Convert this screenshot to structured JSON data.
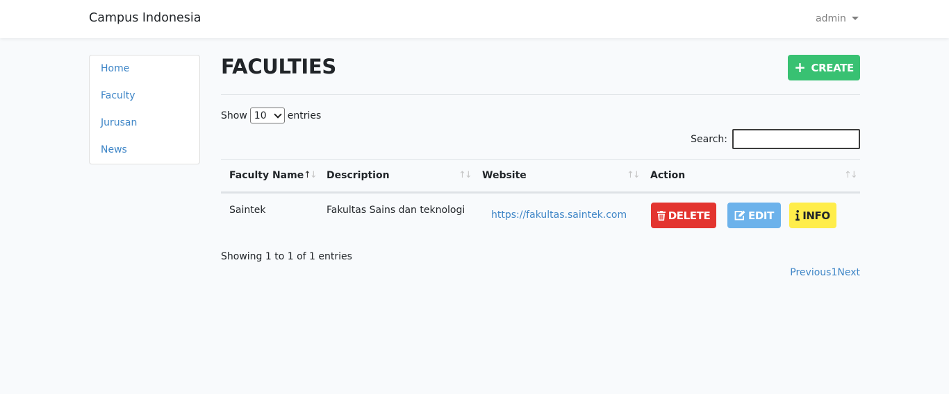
{
  "navbar": {
    "brand": "Campus Indonesia",
    "user": "admin"
  },
  "sidebar": {
    "items": [
      {
        "label": "Home"
      },
      {
        "label": "Faculty"
      },
      {
        "label": "Jurusan"
      },
      {
        "label": "News"
      }
    ]
  },
  "page": {
    "title": "FACULTIES",
    "create_label": "CREATE"
  },
  "datatable": {
    "show_label": "Show",
    "entries_label": "entries",
    "page_length": "10",
    "search_label": "Search:",
    "search_value": "",
    "columns": [
      "Faculty Name",
      "Description",
      "Website",
      "Action"
    ],
    "rows": [
      {
        "name": "Saintek",
        "description": "Fakultas Sains dan teknologi",
        "website": "https://fakultas.saintek.com",
        "actions": {
          "delete": "DELETE",
          "edit": "EDIT",
          "info": "INFO"
        }
      }
    ],
    "info": "Showing 1 to 1 of 1 entries",
    "pagination": {
      "previous": "Previous",
      "current": "1",
      "next": "Next"
    }
  },
  "colors": {
    "primary_link": "#3f86c7",
    "create": "#38c172",
    "delete": "#e3342f",
    "edit": "#6cb2eb",
    "info": "#ffed4a"
  },
  "icons": {
    "create": "plus-icon",
    "delete": "trash-icon",
    "edit": "edit-icon",
    "info": "info-icon",
    "user_menu": "caret-down-icon",
    "sort": "sort-arrows-icon"
  }
}
